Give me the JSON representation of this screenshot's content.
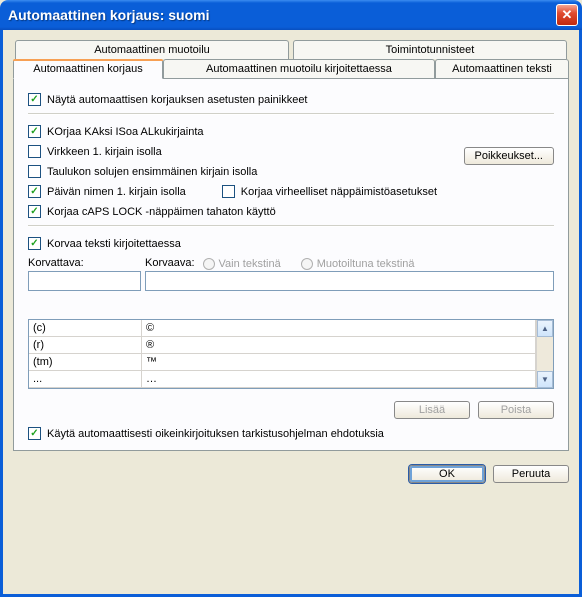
{
  "window": {
    "title": "Automaattinen korjaus: suomi"
  },
  "tabs": {
    "top": [
      {
        "label": "Automaattinen muotoilu"
      },
      {
        "label": "Toimintotunnisteet"
      }
    ],
    "bottom": [
      {
        "label": "Automaattinen korjaus"
      },
      {
        "label": "Automaattinen muotoilu kirjoitettaessa"
      },
      {
        "label": "Automaattinen teksti"
      }
    ]
  },
  "options": {
    "show_buttons": "Näytä automaattisen korjauksen asetusten painikkeet",
    "two_caps": "KOrjaa KAksi ISoa ALkukirjainta",
    "sentence_cap": "Virkkeen 1. kirjain isolla",
    "table_cell_cap": "Taulukon solujen ensimmäinen kirjain isolla",
    "day_cap": "Päivän nimen 1. kirjain isolla",
    "fix_keyboard": "Korjaa virheelliset näppäimistöasetukset",
    "caps_lock": "Korjaa cAPS LOCK -näppäimen tahaton käyttö",
    "replace_text": "Korvaa teksti kirjoitettaessa",
    "use_spellcheck": "Käytä automaattisesti oikeinkirjoituksen tarkistusohjelman ehdotuksia"
  },
  "buttons": {
    "exceptions": "Poikkeukset...",
    "add": "Lisää",
    "remove": "Poista",
    "ok": "OK",
    "cancel": "Peruuta"
  },
  "replace_section": {
    "replace_label": "Korvattava:",
    "with_label": "Korvaava:",
    "radio_plain": "Vain tekstinä",
    "radio_formatted": "Muotoiltuna tekstinä",
    "replace_value": "",
    "with_value": ""
  },
  "table": {
    "rows": [
      {
        "a": "(c)",
        "b": "©"
      },
      {
        "a": "(r)",
        "b": "®"
      },
      {
        "a": "(tm)",
        "b": "™"
      },
      {
        "a": "...",
        "b": "…"
      }
    ]
  }
}
